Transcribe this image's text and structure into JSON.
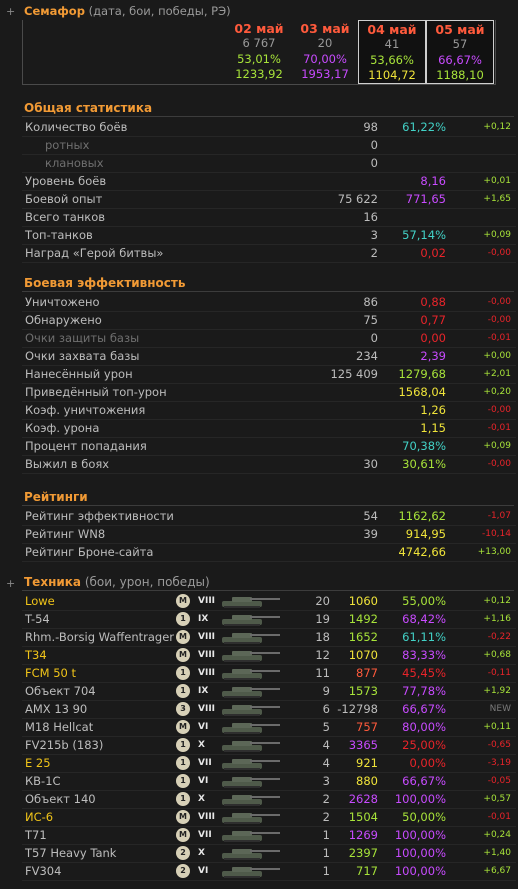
{
  "semaphore": {
    "title": "Семафор",
    "subtitle": "(дата, бои, победы, РЭ)",
    "columns": [
      {
        "date": "02 май",
        "battles": "6 767",
        "winrate": "53,01%",
        "re": "1233,92",
        "date_color": "#ff5a3c",
        "winrate_color": "#a8e43a",
        "re_color": "#a8e43a"
      },
      {
        "date": "03 май",
        "battles": "20",
        "winrate": "70,00%",
        "re": "1953,17",
        "date_color": "#ff5a3c",
        "winrate_color": "#c84bff",
        "re_color": "#c84bff"
      },
      {
        "date": "04 май",
        "battles": "41",
        "winrate": "53,66%",
        "re": "1104,72",
        "date_color": "#ff5a3c",
        "winrate_color": "#a8e43a",
        "re_color": "#f0e43a"
      },
      {
        "date": "05 май",
        "battles": "57",
        "winrate": "66,67%",
        "re": "1188,10",
        "date_color": "#ff5a3c",
        "winrate_color": "#c84bff",
        "re_color": "#a8e43a"
      }
    ]
  },
  "general": {
    "title": "Общая статистика",
    "rows": [
      {
        "label": "Количество боёв",
        "v1": "98",
        "v2": "61,22%",
        "v2_color": "#42d1c6",
        "v3": "+0,12",
        "v3_color": "#a8e43a"
      },
      {
        "label": "ротных",
        "v1": "0",
        "v2": "",
        "v2_color": "",
        "v3": "",
        "v3_color": "",
        "sub": true
      },
      {
        "label": "клановых",
        "v1": "0",
        "v2": "",
        "v2_color": "",
        "v3": "",
        "v3_color": "",
        "sub": true
      },
      {
        "label": "Уровень боёв",
        "v1": "",
        "v2": "8,16",
        "v2_color": "#c84bff",
        "v3": "+0,01",
        "v3_color": "#a8e43a"
      },
      {
        "label": "Боевой опыт",
        "v1": "75 622",
        "v2": "771,65",
        "v2_color": "#c84bff",
        "v3": "+1,65",
        "v3_color": "#a8e43a"
      },
      {
        "label": "Всего танков",
        "v1": "16",
        "v2": "",
        "v2_color": "",
        "v3": "",
        "v3_color": ""
      },
      {
        "label": "Топ-танков",
        "v1": "3",
        "v2": "57,14%",
        "v2_color": "#42d1c6",
        "v3": "+0,09",
        "v3_color": "#a8e43a"
      },
      {
        "label": "Наград «Герой битвы»",
        "v1": "2",
        "v2": "0,02",
        "v2_color": "#e8242a",
        "v3": "-0,00",
        "v3_color": "#e8242a"
      }
    ]
  },
  "efficiency": {
    "title": "Боевая эффективность",
    "rows": [
      {
        "label": "Уничтожено",
        "v1": "86",
        "v2": "0,88",
        "v2_color": "#e8242a",
        "v3": "-0,00",
        "v3_color": "#e8242a"
      },
      {
        "label": "Обнаружено",
        "v1": "75",
        "v2": "0,77",
        "v2_color": "#e8242a",
        "v3": "-0,00",
        "v3_color": "#e8242a"
      },
      {
        "label": "Очки защиты базы",
        "v1": "0",
        "v2": "0,00",
        "v2_color": "#e8242a",
        "v3": "-0,01",
        "v3_color": "#e8242a",
        "dim": true
      },
      {
        "label": "Очки захвата базы",
        "v1": "234",
        "v2": "2,39",
        "v2_color": "#c84bff",
        "v3": "+0,00",
        "v3_color": "#a8e43a"
      },
      {
        "label": "Нанесённый урон",
        "v1": "125 409",
        "v2": "1279,68",
        "v2_color": "#a8e43a",
        "v3": "+2,01",
        "v3_color": "#a8e43a"
      },
      {
        "label": "Приведённый топ-урон",
        "v1": "",
        "v2": "1568,04",
        "v2_color": "#f0e43a",
        "v3": "+0,20",
        "v3_color": "#a8e43a"
      },
      {
        "label": "Коэф. уничтожения",
        "v1": "",
        "v2": "1,26",
        "v2_color": "#f0e43a",
        "v3": "-0,00",
        "v3_color": "#e8242a"
      },
      {
        "label": "Коэф. урона",
        "v1": "",
        "v2": "1,15",
        "v2_color": "#f0e43a",
        "v3": "-0,01",
        "v3_color": "#e8242a"
      },
      {
        "label": "Процент попадания",
        "v1": "",
        "v2": "70,38%",
        "v2_color": "#42d1c6",
        "v3": "+0,09",
        "v3_color": "#a8e43a"
      },
      {
        "label": "Выжил в боях",
        "v1": "30",
        "v2": "30,61%",
        "v2_color": "#a8e43a",
        "v3": "-0,00",
        "v3_color": "#e8242a"
      }
    ]
  },
  "ratings": {
    "title": "Рейтинги",
    "rows": [
      {
        "label": "Рейтинг эффективности",
        "v1": "54",
        "v2": "1162,62",
        "v2_color": "#a8e43a",
        "v3": "-1,07",
        "v3_color": "#e8242a"
      },
      {
        "label": "Рейтинг WN8",
        "v1": "39",
        "v2": "914,95",
        "v2_color": "#f0e43a",
        "v3": "-10,14",
        "v3_color": "#e8242a"
      },
      {
        "label": "Рейтинг Броне-сайта",
        "v1": "",
        "v2": "4742,66",
        "v2_color": "#f0e43a",
        "v3": "+13,00",
        "v3_color": "#a8e43a"
      }
    ]
  },
  "vehicles": {
    "title": "Техника",
    "subtitle": "(бои, урон, победы)",
    "rows": [
      {
        "name": "Lowe",
        "name_color": "#f0c419",
        "badge": "M",
        "tier": "VIII",
        "battles": "20",
        "damage": "1060",
        "damage_color": "#f0e43a",
        "winrate": "55,00%",
        "winrate_color": "#a8e43a",
        "delta": "+0,12",
        "delta_color": "#a8e43a"
      },
      {
        "name": "T-54",
        "name_color": "#bdbdbd",
        "badge": "1",
        "tier": "IX",
        "battles": "19",
        "damage": "1492",
        "damage_color": "#a8e43a",
        "winrate": "68,42%",
        "winrate_color": "#c84bff",
        "delta": "+1,16",
        "delta_color": "#a8e43a"
      },
      {
        "name": "Rhm.-Borsig Waffentrager",
        "name_color": "#bdbdbd",
        "badge": "M",
        "tier": "VIII",
        "battles": "18",
        "damage": "1652",
        "damage_color": "#a8e43a",
        "winrate": "61,11%",
        "winrate_color": "#42d1c6",
        "delta": "-0,22",
        "delta_color": "#e8242a"
      },
      {
        "name": "T34",
        "name_color": "#f0c419",
        "badge": "M",
        "tier": "VIII",
        "battles": "12",
        "damage": "1070",
        "damage_color": "#f0e43a",
        "winrate": "83,33%",
        "winrate_color": "#c84bff",
        "delta": "+0,68",
        "delta_color": "#a8e43a"
      },
      {
        "name": "FCM 50 t",
        "name_color": "#f0c419",
        "badge": "1",
        "tier": "VIII",
        "battles": "11",
        "damage": "877",
        "damage_color": "#ff5a3c",
        "winrate": "45,45%",
        "winrate_color": "#e8242a",
        "delta": "-0,11",
        "delta_color": "#e8242a"
      },
      {
        "name": "Объект 704",
        "name_color": "#bdbdbd",
        "badge": "1",
        "tier": "IX",
        "battles": "9",
        "damage": "1573",
        "damage_color": "#a8e43a",
        "winrate": "77,78%",
        "winrate_color": "#c84bff",
        "delta": "+1,92",
        "delta_color": "#a8e43a"
      },
      {
        "name": "AMX 13 90",
        "name_color": "#bdbdbd",
        "badge": "3",
        "tier": "VIII",
        "battles": "6",
        "damage": "-12798",
        "damage_color": "#bdbdbd",
        "winrate": "66,67%",
        "winrate_color": "#c84bff",
        "delta": "NEW",
        "delta_color": "#7a7a7a"
      },
      {
        "name": "M18 Hellcat",
        "name_color": "#bdbdbd",
        "badge": "M",
        "tier": "VI",
        "battles": "5",
        "damage": "757",
        "damage_color": "#ff5a3c",
        "winrate": "80,00%",
        "winrate_color": "#c84bff",
        "delta": "+0,11",
        "delta_color": "#a8e43a"
      },
      {
        "name": "FV215b (183)",
        "name_color": "#bdbdbd",
        "badge": "1",
        "tier": "X",
        "battles": "4",
        "damage": "3365",
        "damage_color": "#c84bff",
        "winrate": "25,00%",
        "winrate_color": "#e8242a",
        "delta": "-0,65",
        "delta_color": "#e8242a"
      },
      {
        "name": "E 25",
        "name_color": "#f0c419",
        "badge": "1",
        "tier": "VII",
        "battles": "4",
        "damage": "921",
        "damage_color": "#f0e43a",
        "winrate": "0,00%",
        "winrate_color": "#e8242a",
        "delta": "-3,19",
        "delta_color": "#e8242a"
      },
      {
        "name": "КВ-1С",
        "name_color": "#bdbdbd",
        "badge": "1",
        "tier": "VI",
        "battles": "3",
        "damage": "880",
        "damage_color": "#f0e43a",
        "winrate": "66,67%",
        "winrate_color": "#c84bff",
        "delta": "-0,05",
        "delta_color": "#e8242a"
      },
      {
        "name": "Объект 140",
        "name_color": "#bdbdbd",
        "badge": "1",
        "tier": "X",
        "battles": "2",
        "damage": "2628",
        "damage_color": "#c84bff",
        "winrate": "100,00%",
        "winrate_color": "#c84bff",
        "delta": "+0,57",
        "delta_color": "#a8e43a"
      },
      {
        "name": "ИС-6",
        "name_color": "#f0c419",
        "badge": "M",
        "tier": "VIII",
        "battles": "2",
        "damage": "1504",
        "damage_color": "#a8e43a",
        "winrate": "50,00%",
        "winrate_color": "#a8e43a",
        "delta": "-0,01",
        "delta_color": "#e8242a"
      },
      {
        "name": "T71",
        "name_color": "#bdbdbd",
        "badge": "M",
        "tier": "VII",
        "battles": "1",
        "damage": "1269",
        "damage_color": "#c84bff",
        "winrate": "100,00%",
        "winrate_color": "#c84bff",
        "delta": "+0,24",
        "delta_color": "#a8e43a"
      },
      {
        "name": "T57 Heavy Tank",
        "name_color": "#bdbdbd",
        "badge": "2",
        "tier": "X",
        "battles": "1",
        "damage": "2397",
        "damage_color": "#a8e43a",
        "winrate": "100,00%",
        "winrate_color": "#c84bff",
        "delta": "+1,40",
        "delta_color": "#a8e43a"
      },
      {
        "name": "FV304",
        "name_color": "#bdbdbd",
        "badge": "2",
        "tier": "VI",
        "battles": "1",
        "damage": "717",
        "damage_color": "#a8e43a",
        "winrate": "100,00%",
        "winrate_color": "#c84bff",
        "delta": "+6,67",
        "delta_color": "#a8e43a"
      }
    ]
  }
}
